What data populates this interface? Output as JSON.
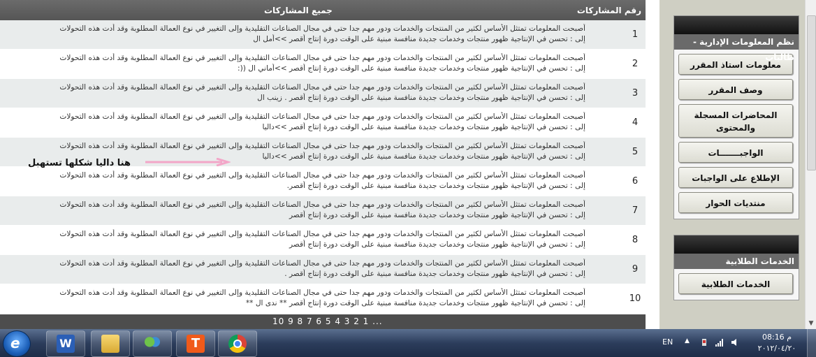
{
  "table": {
    "col_number": "رقم المشاركات",
    "col_all": "جميع المشاركات",
    "rows": [
      {
        "num": "1",
        "line1": "أصبحت المعلومات تمتثل الأساس لكثير من المنتجات والخدمات ودور مهم جدا حتى في مجال الصناعات التقليدية وإلى التغيير في نوع العمالة المطلوبة وقد أدت هذه التحولات",
        "line2": "إلى : تحسن في الإنتاجية ظهور منتجات وخدمات جديدة منافسة مبنية على الوقت دورة إنتاج أقصر >>أمل ال"
      },
      {
        "num": "2",
        "line1": "أصبحت المعلومات تمتثل الأساس لكثير من المنتجات والخدمات ودور مهم جدا حتى في مجال الصناعات التقليدية وإلى التغيير في نوع العمالة المطلوبة وقد أدت هذه التحولات",
        "line2": "إلى : تحسن في الإنتاجية ظهور منتجات وخدمات جديدة منافسة مبنية على الوقت دورة إنتاج أقصر >>أماني ال ((:"
      },
      {
        "num": "3",
        "line1": "أصبحت المعلومات تمتثل الأساس لكثير من المنتجات والخدمات ودور مهم جدا حتى في مجال الصناعات التقليدية وإلى التغيير في نوع العمالة المطلوبة وقد أدت هذه التحولات",
        "line2": "إلى : تحسن في الإنتاجية ظهور منتجات وخدمات جديدة منافسة مبنية على الوقت دورة إنتاج أقصر . زينب ال"
      },
      {
        "num": "4",
        "line1": "أصبحت المعلومات تمتثل الأساس لكثير من المنتجات والخدمات ودور مهم جدا حتى في مجال الصناعات التقليدية وإلى التغيير في نوع العمالة المطلوبة وقد أدت هذه التحولات",
        "line2": "إلى : تحسن في الإنتاجية ظهور منتجات وخدمات جديدة منافسة مبنية على الوقت دورة إنتاج أقصر >>داليا"
      },
      {
        "num": "5",
        "line1": "أصبحت المعلومات تمتثل الأساس لكثير من المنتجات والخدمات ودور مهم جدا حتى في مجال الصناعات التقليدية وإلى التغيير في نوع العمالة المطلوبة وقد أدت هذه التحولات",
        "line2": "إلى : تحسن في الإنتاجية ظهور منتجات وخدمات جديدة منافسة مبنية على الوقت دورة إنتاج أقصر >>داليا"
      },
      {
        "num": "6",
        "line1": "أصبحت المعلومات تمتثل الأساس لكثير من المنتجات والخدمات ودور مهم جدا حتى في مجال الصناعات التقليدية وإلى التغيير في نوع العمالة المطلوبة وقد أدت هذه التحولات",
        "line2": "إلى : تحسن في الإنتاجية ظهور منتجات وخدمات جديدة منافسة مبنية على الوقت دورة إنتاج أقصر."
      },
      {
        "num": "7",
        "line1": "أصبحت المعلومات تمتثل الأساس لكثير من المنتجات والخدمات ودور مهم جدا حتى في مجال الصناعات التقليدية وإلى التغيير في نوع العمالة المطلوبة وقد أدت هذه التحولات",
        "line2": "إلى : تحسن في الإنتاجية ظهور منتجات وخدمات جديدة منافسة مبنية على الوقت دورة إنتاج أقصر"
      },
      {
        "num": "8",
        "line1": "أصبحت المعلومات تمتثل الأساس لكثير من المنتجات والخدمات ودور مهم جدا حتى في مجال الصناعات التقليدية وإلى التغيير في نوع العمالة المطلوبة وقد أدت هذه التحولات",
        "line2": "إلى : تحسن في الإنتاجية ظهور منتجات وخدمات جديدة منافسة مبنية على الوقت دورة إنتاج أقصر"
      },
      {
        "num": "9",
        "line1": "أصبحت المعلومات تمتثل الأساس لكثير من المنتجات والخدمات ودور مهم جدا حتى في مجال الصناعات التقليدية وإلى التغيير في نوع العمالة المطلوبة وقد أدت هذه التحولات",
        "line2": "إلى : تحسن في الإنتاجية ظهور منتجات وخدمات جديدة منافسة مبنية على الوقت دورة إنتاج أقصر ."
      },
      {
        "num": "10",
        "line1": "أصبحت المعلومات تمتثل الأساس لكثير من المنتجات والخدمات ودور مهم جدا حتى في مجال الصناعات التقليدية وإلى التغيير في نوع العمالة المطلوبة وقد أدت هذه التحولات",
        "line2": "إلى : تحسن في الإنتاجية ظهور منتجات وخدمات جديدة منافسة مبنية على الوقت دورة إنتاج أقصر ** ندى ال **"
      }
    ],
    "pager": "10 9 8 7 6 5 4 3 2 1 ..."
  },
  "annotation": "هنا داليا شكلها تستهبل",
  "panel1": {
    "title": "نظم المعلومات الإدارية - طالبات",
    "buttons": [
      "معلومات استاذ المقرر",
      "وصف المقرر",
      "المحاضرات المسجلة والمحتوى",
      "الواجبـــــــات",
      "الإطلاع على الواجبات",
      "منتديات الحوار"
    ]
  },
  "panel2": {
    "title": "الخدمات الطلابية",
    "buttons": [
      "الخدمات الطلابية"
    ]
  },
  "taskbar": {
    "apps": [
      "app",
      "word-icon",
      "folder-icon",
      "people-icon",
      "t-icon",
      "chrome-icon"
    ],
    "lang": "EN",
    "time": "08:16 م",
    "date": "٢٠١٢/٠٤/٢٠"
  }
}
